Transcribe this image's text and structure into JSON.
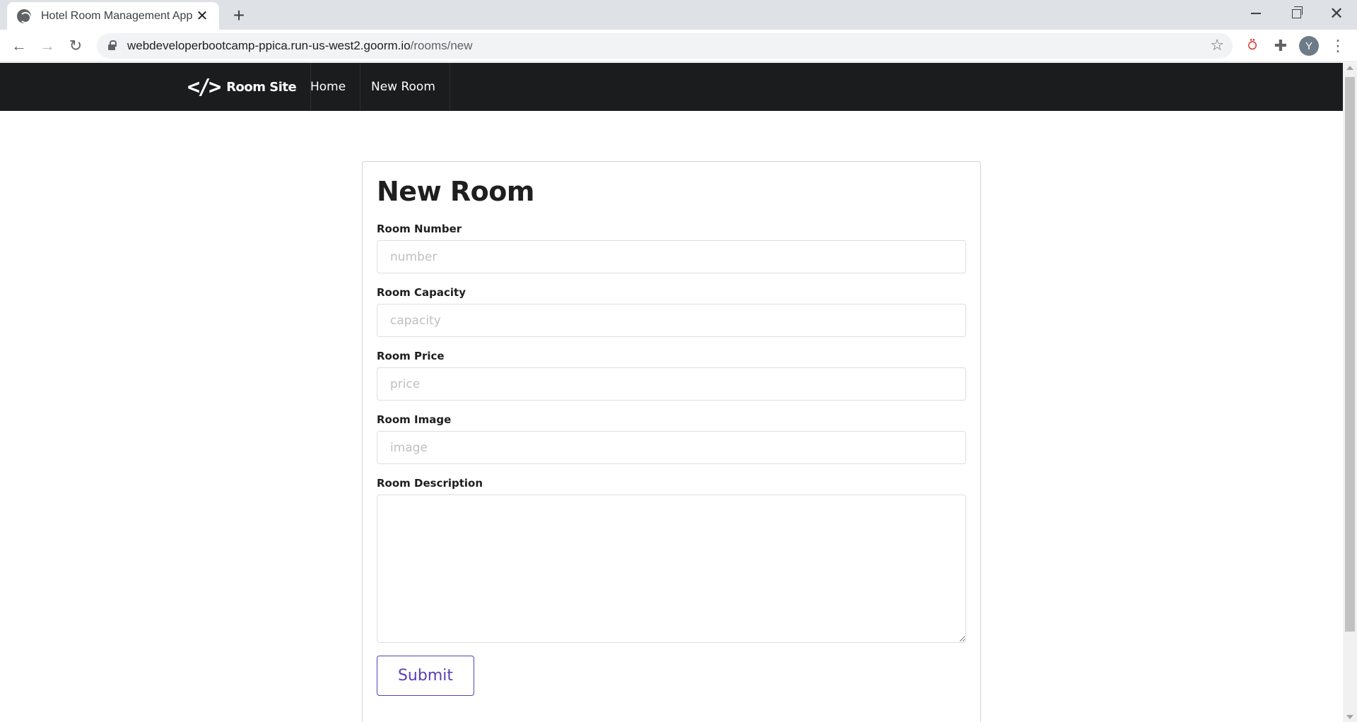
{
  "browser": {
    "tab_title": "Hotel Room Management App",
    "url_host": "webdeveloperbootcamp-ppica.run-us-west2.goorm.io",
    "url_path": "/rooms/new",
    "avatar_letter": "Y"
  },
  "site": {
    "brand": "Room Site",
    "nav": {
      "home": "Home",
      "new_room": "New Room"
    }
  },
  "form": {
    "title": "New Room",
    "fields": {
      "number": {
        "label": "Room Number",
        "placeholder": "number",
        "value": ""
      },
      "capacity": {
        "label": "Room Capacity",
        "placeholder": "capacity",
        "value": ""
      },
      "price": {
        "label": "Room Price",
        "placeholder": "price",
        "value": ""
      },
      "image": {
        "label": "Room Image",
        "placeholder": "image",
        "value": ""
      },
      "description": {
        "label": "Room Description",
        "value": ""
      }
    },
    "submit_label": "Submit"
  },
  "colors": {
    "navbar_bg": "#1b1c1d",
    "submit_accent": "#5a3fb8"
  }
}
